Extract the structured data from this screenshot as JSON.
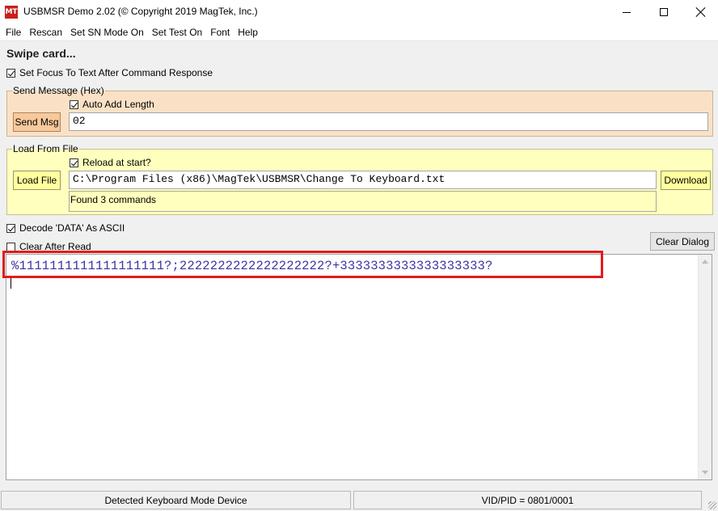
{
  "window": {
    "title": "USBMSR Demo 2.02 (© Copyright 2019 MagTek, Inc.)",
    "icon": "magtek-logo-icon",
    "icon_text": "MT"
  },
  "menu": [
    "File",
    "Rescan",
    "Set SN Mode On",
    "Set Test On",
    "Font",
    "Help"
  ],
  "status_prompt": "Swipe card...",
  "options": {
    "set_focus_label": "Set Focus To Text After Command Response",
    "set_focus_checked": true,
    "decode_label": "Decode 'DATA' As ASCII",
    "decode_checked": true,
    "clear_after_read_label": "Clear After Read",
    "clear_after_read_checked": false
  },
  "send_message": {
    "legend": "Send Message (Hex)",
    "auto_add_length_label": "Auto Add Length",
    "auto_add_length_checked": true,
    "button_label": "Send Msg",
    "value": "02"
  },
  "load_from_file": {
    "legend": "Load From File",
    "reload_label": "Reload at start?",
    "reload_checked": true,
    "load_button_label": "Load File",
    "file_path": "C:\\Program Files (x86)\\MagTek\\USBMSR\\Change To Keyboard.txt",
    "download_button_label": "Download",
    "found_text": "Found 3 commands"
  },
  "clear_dialog_label": "Clear Dialog",
  "output_text": "%1111111111111111111?;2222222222222222222?+3333333333333333333?",
  "statusbar": {
    "left": "Detected Keyboard Mode Device",
    "right": "VID/PID = 0801/0001"
  },
  "colors": {
    "send_group_bg": "#fae1c6",
    "load_group_bg": "#ffffbe",
    "output_text": "#3d35a6",
    "highlight": "#e21b1b"
  }
}
